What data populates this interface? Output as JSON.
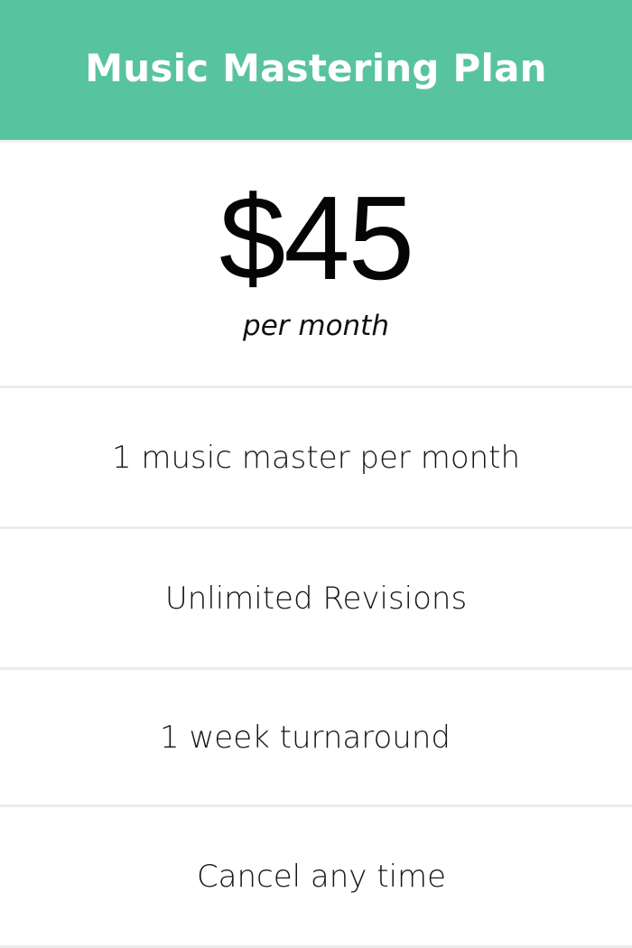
{
  "plan": {
    "title": "Music Mastering Plan",
    "price": "$45",
    "billing_period": "per month",
    "features": [
      "1 music master per month",
      "Unlimited Revisions",
      "1 week turnaround",
      "Cancel any time"
    ]
  },
  "colors": {
    "header_background": "#58c39f",
    "header_text": "#ffffff",
    "divider": "#ececec"
  }
}
